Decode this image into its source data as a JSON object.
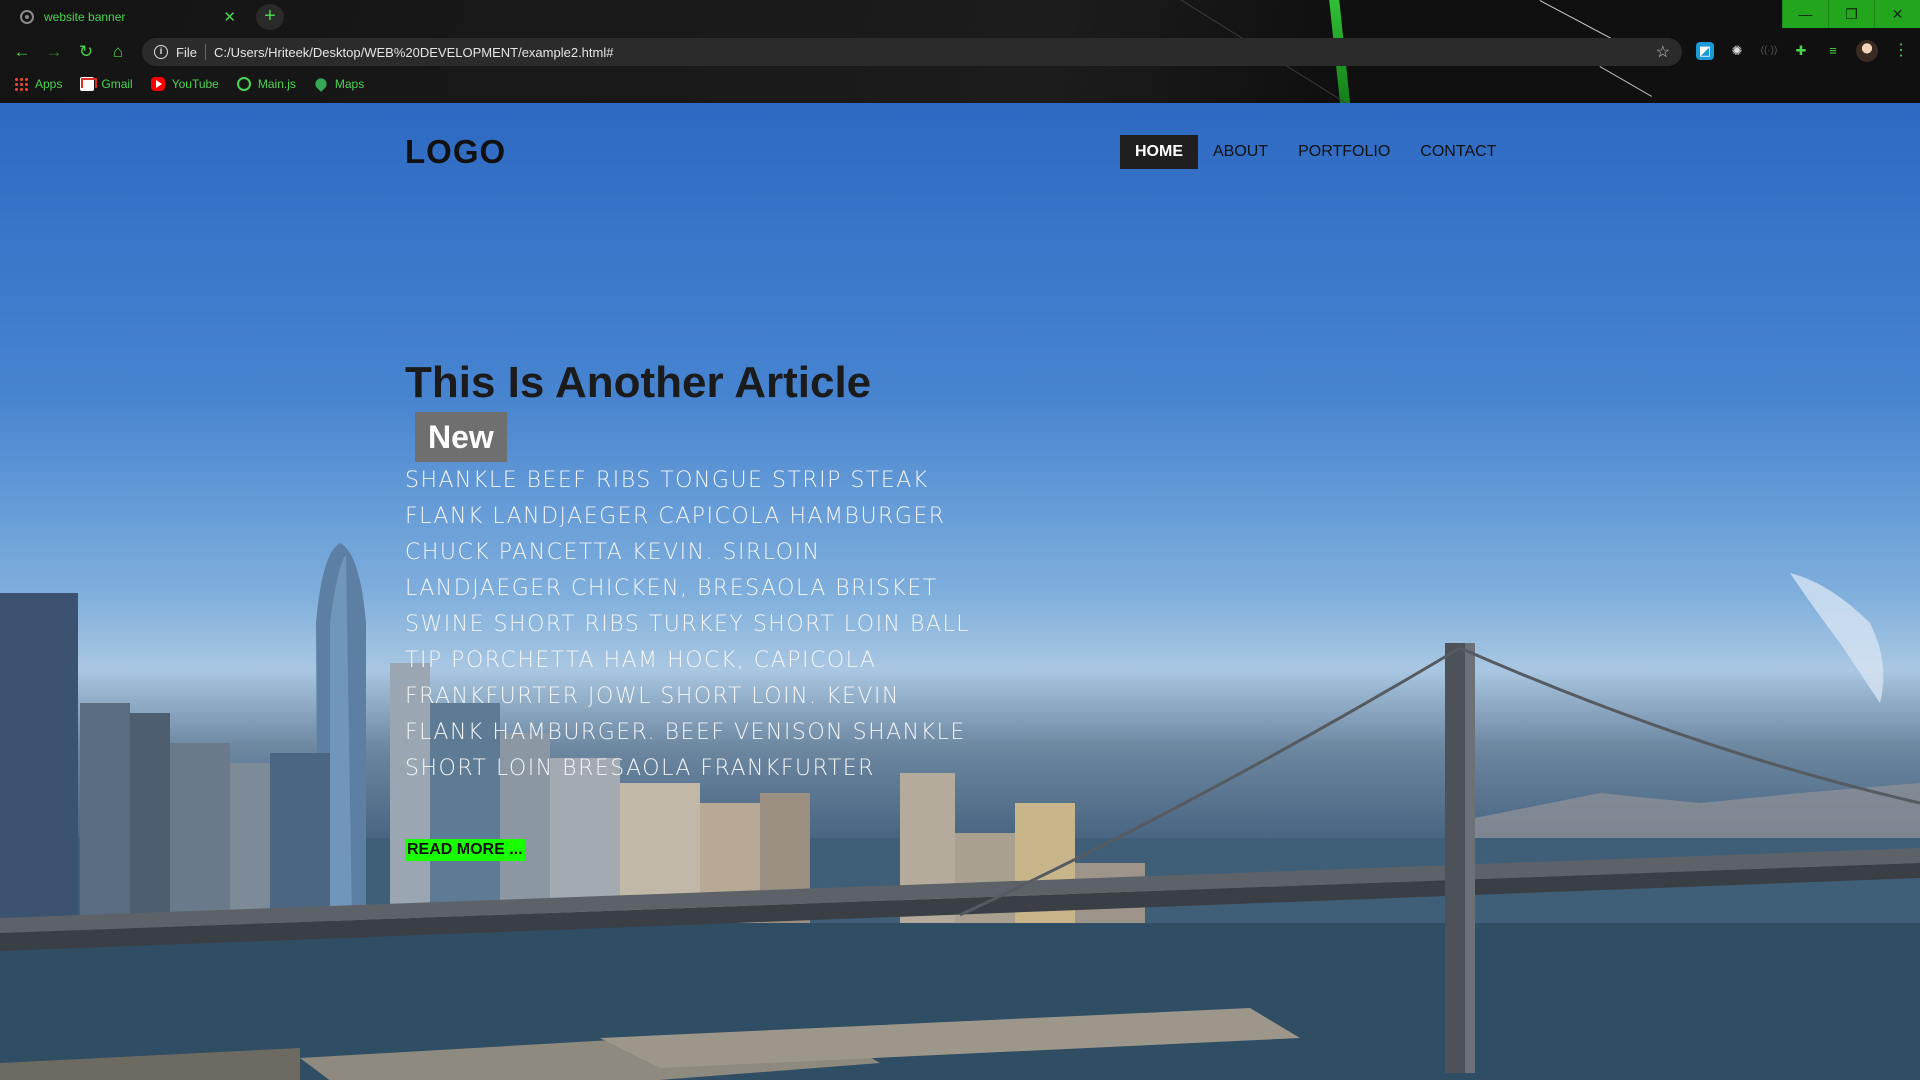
{
  "browser": {
    "tab_title": "website banner",
    "url_scheme": "File",
    "url": "C:/Users/Hriteek/Desktop/WEB%20DEVELOPMENT/example2.html#",
    "bookmarks": [
      {
        "label": "Apps",
        "icon": "apps-grid-icon"
      },
      {
        "label": "Gmail",
        "icon": "gmail-icon"
      },
      {
        "label": "YouTube",
        "icon": "youtube-icon"
      },
      {
        "label": "Main.js",
        "icon": "globe-icon"
      },
      {
        "label": "Maps",
        "icon": "maps-pin-icon"
      }
    ],
    "window_controls": {
      "minimize": "—",
      "restore": "❐",
      "close": "✕"
    },
    "accent_color": "#4cd34f"
  },
  "page": {
    "logo": "LOGO",
    "nav": [
      "HOME",
      "ABOUT",
      "PORTFOLIO",
      "CONTACT"
    ],
    "active_nav": "HOME",
    "headline": "This Is Another Article",
    "badge": "New",
    "body": "Shankle beef ribs tongue strip steak flank landjaeger capicola hamburger chuck pancetta kevin. Sirloin landjaeger chicken, bresaola brisket swine short ribs turkey short loin ball tip porchetta ham hock, capicola frankfurter jowl short loin. Kevin flank hamburger. Beef venison shankle short loin bresaola frankfurter",
    "read_more": "READ MORE ...",
    "colors": {
      "read_more_bg": "#19ff00",
      "nav_active_bg": "#1f1f1f",
      "badge_bg": "#6f6f6f"
    }
  }
}
